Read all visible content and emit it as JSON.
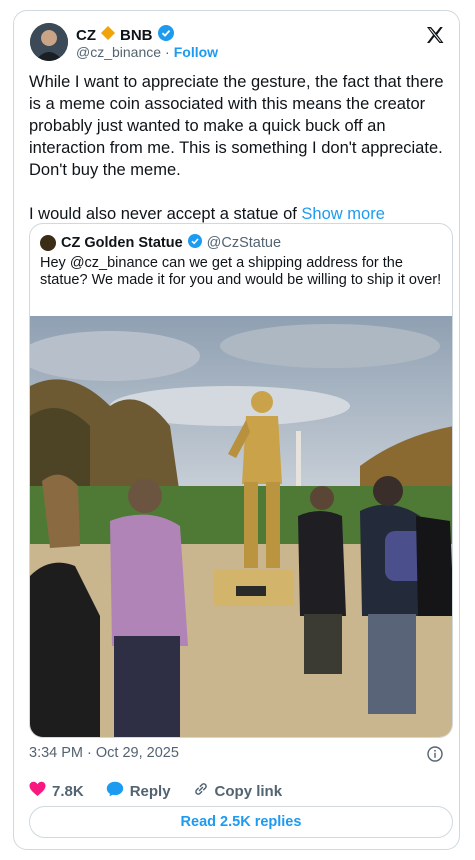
{
  "author": {
    "name": "CZ",
    "badge_text": "BNB",
    "handle": "@cz_binance",
    "separator": "·",
    "follow_label": "Follow"
  },
  "tweet": {
    "paragraph1": "While I want to appreciate the gesture, the fact that there is a meme coin associated with this means the creator probably just wanted to make a quick buck off an interaction from me. This is something I don't appreciate. Don't buy the meme.",
    "paragraph2": "I would also never accept a statue of",
    "show_more_label": "Show more"
  },
  "quote": {
    "name": "CZ Golden Statue",
    "handle": "@CzStatue",
    "text": "Hey @cz_binance can we get a shipping address for the statue? We made it for you and would be willing to ship it over!"
  },
  "meta": {
    "timestamp": "3:34 PM · Oct 29, 2025"
  },
  "actions": {
    "likes": "7.8K",
    "reply_label": "Reply",
    "copy_label": "Copy link"
  },
  "read_replies_label": "Read 2.5K replies",
  "colors": {
    "accent": "#1d9bf0",
    "like": "#f91880",
    "bnb": "#f0b90b",
    "statue_gold": "#c9a24a"
  },
  "icons": [
    "x-logo-icon",
    "verified-icon",
    "bnb-diamond-icon",
    "info-icon",
    "heart-icon",
    "reply-icon",
    "link-icon"
  ]
}
